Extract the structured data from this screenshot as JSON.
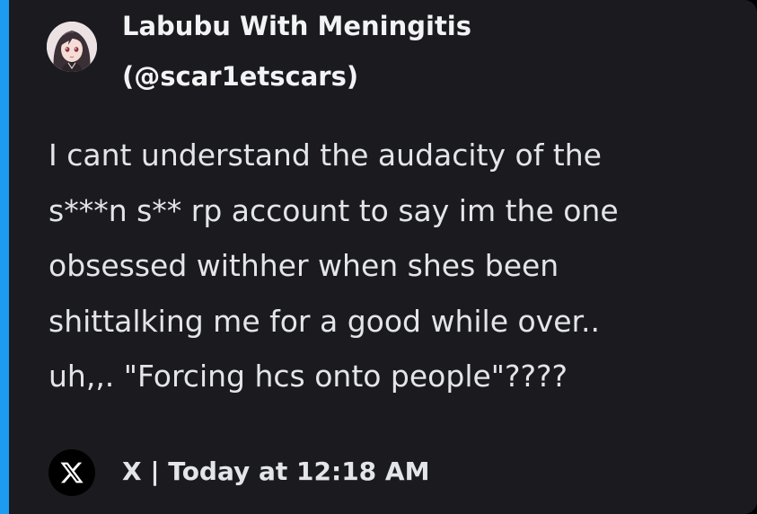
{
  "embed": {
    "accent_color": "#1d9bf0",
    "background_color": "#1b1b1f"
  },
  "author": {
    "name": "Labubu With Meningitis",
    "handle": "(@scar1etscars)",
    "avatar_icon": "anime-girl-avatar"
  },
  "post": {
    "text": "I cant understand the audacity of the\ns***n s** rp account to say im the one\nobsessed withher when shes been\nshittalking me for a good while over..\nuh,,. \"Forcing hcs onto people\"????"
  },
  "footer": {
    "source_icon": "x-logo-icon",
    "text": "X | Today at 12:18 AM"
  }
}
